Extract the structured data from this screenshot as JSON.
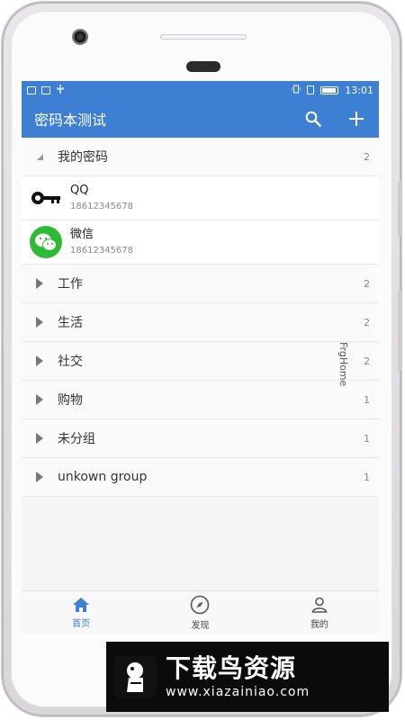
{
  "status": {
    "time": "13:01"
  },
  "appbar": {
    "title": "密码本测试"
  },
  "groups": [
    {
      "name": "我的密码",
      "count": "2",
      "expanded": true,
      "items": [
        {
          "title": "QQ",
          "subtitle": "18612345678",
          "icon": "key-icon"
        },
        {
          "title": "微信",
          "subtitle": "18612345678",
          "icon": "wechat-icon"
        }
      ]
    },
    {
      "name": "工作",
      "count": "2"
    },
    {
      "name": "生活",
      "count": "2"
    },
    {
      "name": "社交",
      "count": "2"
    },
    {
      "name": "购物",
      "count": "1"
    },
    {
      "name": "未分组",
      "count": "1"
    },
    {
      "name": "unkown group",
      "count": "1"
    }
  ],
  "watermark": "FrgHome",
  "bottom_nav": [
    {
      "label": "首页",
      "icon": "home-icon",
      "active": true
    },
    {
      "label": "发现",
      "icon": "compass-icon"
    },
    {
      "label": "我的",
      "icon": "user-icon"
    }
  ],
  "banner": {
    "title": "下载鸟资源",
    "url": "www.xiazainiao.com"
  },
  "colors": {
    "primary": "#3d7fd3",
    "wechat": "#2dbb35"
  }
}
